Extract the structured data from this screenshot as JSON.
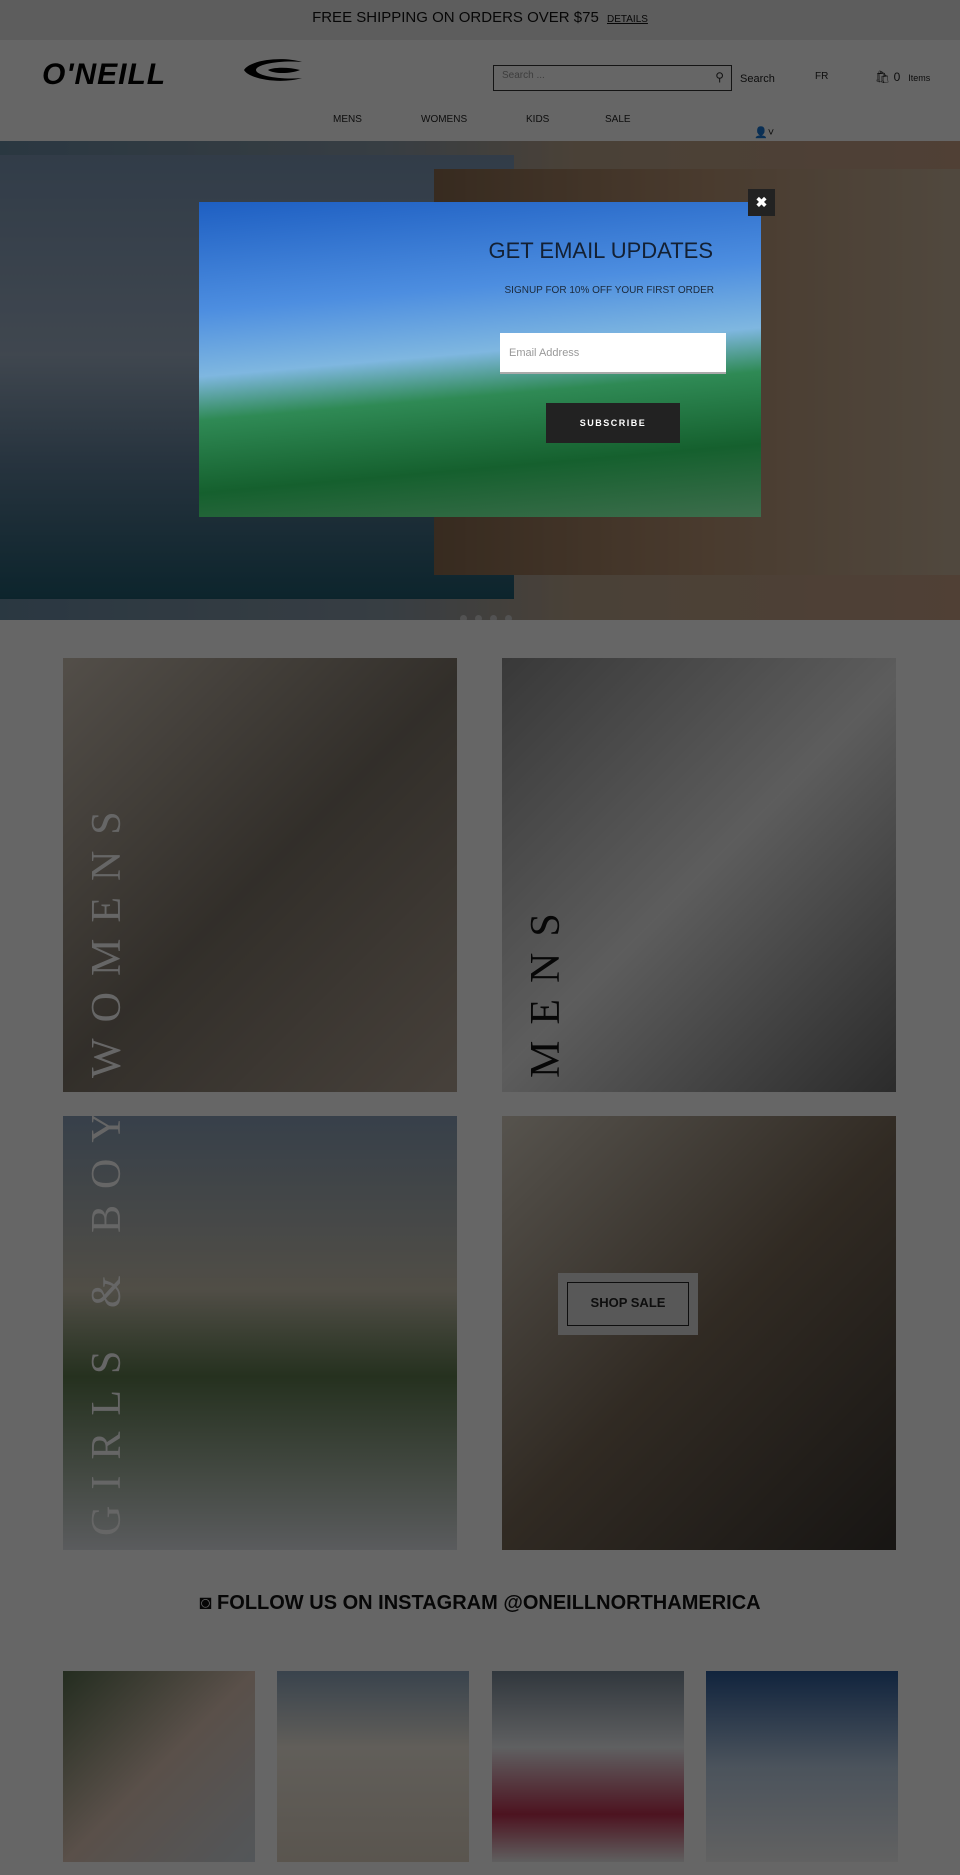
{
  "promo": {
    "text": "FREE SHIPPING ON ORDERS OVER $75",
    "link": "DETAILS"
  },
  "header": {
    "logo": "O'NEILL",
    "search_placeholder": "Search ...",
    "search_label": "Search",
    "lang": "FR",
    "cart_count": "0",
    "cart_label": "Items"
  },
  "nav": [
    {
      "label": "MENS"
    },
    {
      "label": "WOMENS"
    },
    {
      "label": "KIDS"
    },
    {
      "label": "SALE"
    }
  ],
  "tiles": {
    "womens": "WOMENS",
    "mens": "MENS",
    "kids": "GIRLS & BOYS",
    "sale": "SHOP SALE"
  },
  "instagram": {
    "heading": "FOLLOW US ON INSTAGRAM @ONEILLNORTHAMERICA"
  },
  "modal": {
    "title": "GET EMAIL UPDATES",
    "subtitle": "SIGNUP FOR 10% OFF YOUR FIRST ORDER",
    "email_placeholder": "Email Address",
    "subscribe": "SUBSCRIBE",
    "close": "✖"
  },
  "hero": {
    "slides": 4,
    "active_slide": 1
  }
}
